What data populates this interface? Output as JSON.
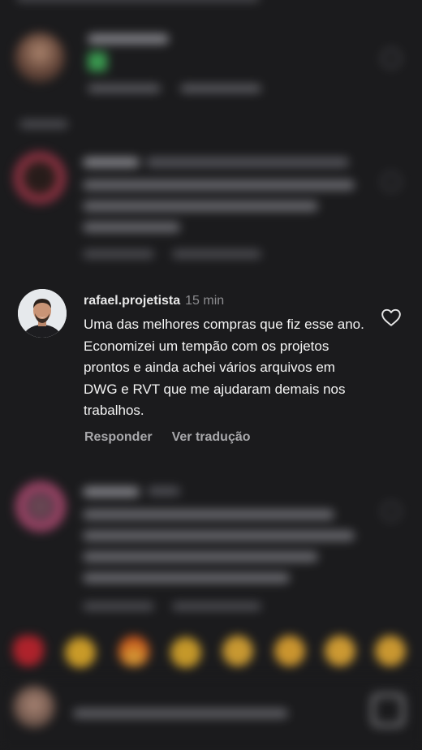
{
  "comments": [
    {
      "username": "rafael.projetista",
      "time": "15 min",
      "text_lines": [
        "Uma das melhores compras que fiz esse ano.",
        "Economizei um tempão com os projetos",
        "prontos e ainda achei vários arquivos em",
        "DWG e RVT que me ajudaram demais nos",
        "trabalhos."
      ],
      "reply_label": "Responder",
      "translate_label": "Ver tradução"
    }
  ],
  "colors": {
    "background": "#1b1b1d",
    "text": "#f4f4f4",
    "muted": "#8d8d90",
    "action": "#a8a8ab"
  },
  "icons": {
    "like": "heart-outline-icon",
    "sticker": "sticker-icon"
  }
}
